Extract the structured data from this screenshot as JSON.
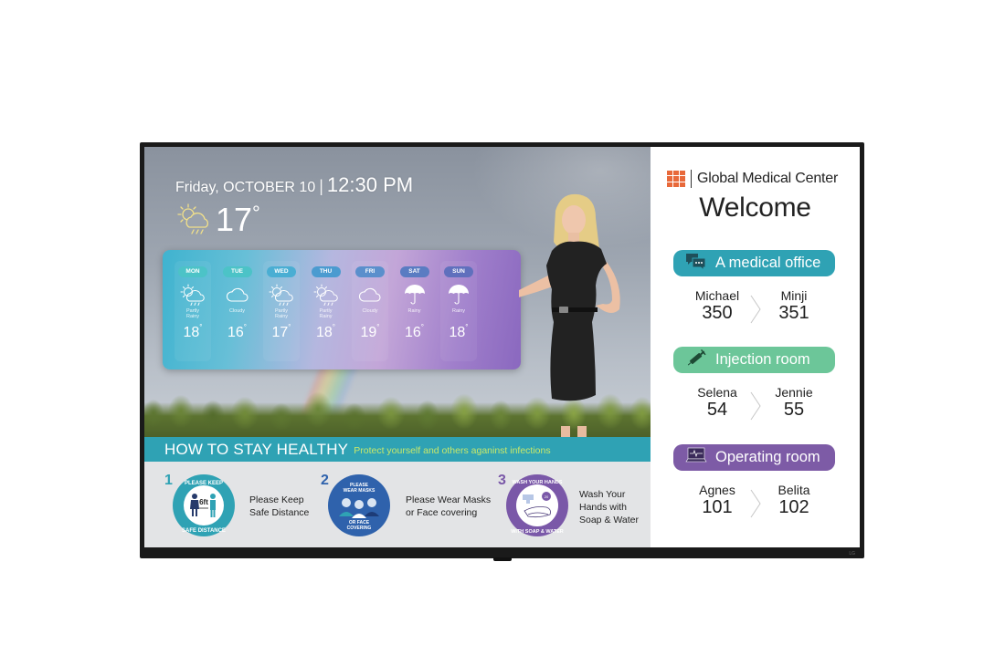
{
  "display": {
    "brand_tag": "LG"
  },
  "weather": {
    "date": "Friday, OCTOBER 10",
    "separator": "|",
    "time": "12:30 PM",
    "current_temp": "17",
    "degree": "°",
    "current_icon": "partly-rainy-icon",
    "forecast": [
      {
        "day": "MON",
        "condition": "Partly\nRainy",
        "temp": "18",
        "icon": "partly-rainy-icon",
        "pill_color": "#4cc3c7"
      },
      {
        "day": "TUE",
        "condition": "Cloudy",
        "temp": "16",
        "icon": "cloud-icon",
        "pill_color": "#4cc3c7"
      },
      {
        "day": "WED",
        "condition": "Partly\nRainy",
        "temp": "17",
        "icon": "partly-rainy-icon",
        "pill_color": "#4aaed3"
      },
      {
        "day": "THU",
        "condition": "Partly\nRainy",
        "temp": "18",
        "icon": "partly-rainy-icon",
        "pill_color": "#4b9bd0"
      },
      {
        "day": "FRI",
        "condition": "Cloudy",
        "temp": "19",
        "icon": "cloud-icon",
        "pill_color": "#5a8fcc"
      },
      {
        "day": "SAT",
        "condition": "Rainy",
        "temp": "16",
        "icon": "umbrella-icon",
        "pill_color": "#5a7cc2"
      },
      {
        "day": "SUN",
        "condition": "Rainy",
        "temp": "18",
        "icon": "umbrella-icon",
        "pill_color": "#6070bd"
      }
    ]
  },
  "health": {
    "title": "HOW TO STAY HEALTHY",
    "subtitle": "Protect yourself and others aganinst infections",
    "tips": [
      {
        "number": "1",
        "badge_top": "PLEASE KEEP",
        "badge_bottom": "SAFE DISTANCE",
        "badge_center": "6ft",
        "text": "Please Keep\nSafe Distance",
        "color": "#2fa2b4",
        "icon": "social-distance-icon"
      },
      {
        "number": "2",
        "badge_top": "PLEASE\nWEAR MASKS",
        "badge_bottom": "OR FACE\nCOVERING",
        "text": "Please Wear Masks\nor Face covering",
        "color": "#2f62ac",
        "icon": "face-mask-icon"
      },
      {
        "number": "3",
        "badge_top": "WASH YOUR HANDS",
        "badge_bottom": "WITH SOAP & WATER",
        "badge_center": "20 sec",
        "text": "Wash Your\nHands with\nSoap & Water",
        "color": "#7a58a8",
        "icon": "hand-wash-icon"
      }
    ]
  },
  "clinic": {
    "name": "Global Medical Center",
    "greeting": "Welcome",
    "logo_color": "#e8693a",
    "rooms": [
      {
        "label": "A medical office",
        "icon": "chat-bubbles-icon",
        "color": "#2fa2b4",
        "current_name": "Michael",
        "current_number": "350",
        "next_name": "Minji",
        "next_number": "351"
      },
      {
        "label": "Injection room",
        "icon": "syringe-icon",
        "color": "#6cc699",
        "current_name": "Selena",
        "current_number": "54",
        "next_name": "Jennie",
        "next_number": "55"
      },
      {
        "label": "Operating room",
        "icon": "monitor-heartbeat-icon",
        "color": "#7d5ba6",
        "current_name": "Agnes",
        "current_number": "101",
        "next_name": "Belita",
        "next_number": "102"
      }
    ]
  }
}
